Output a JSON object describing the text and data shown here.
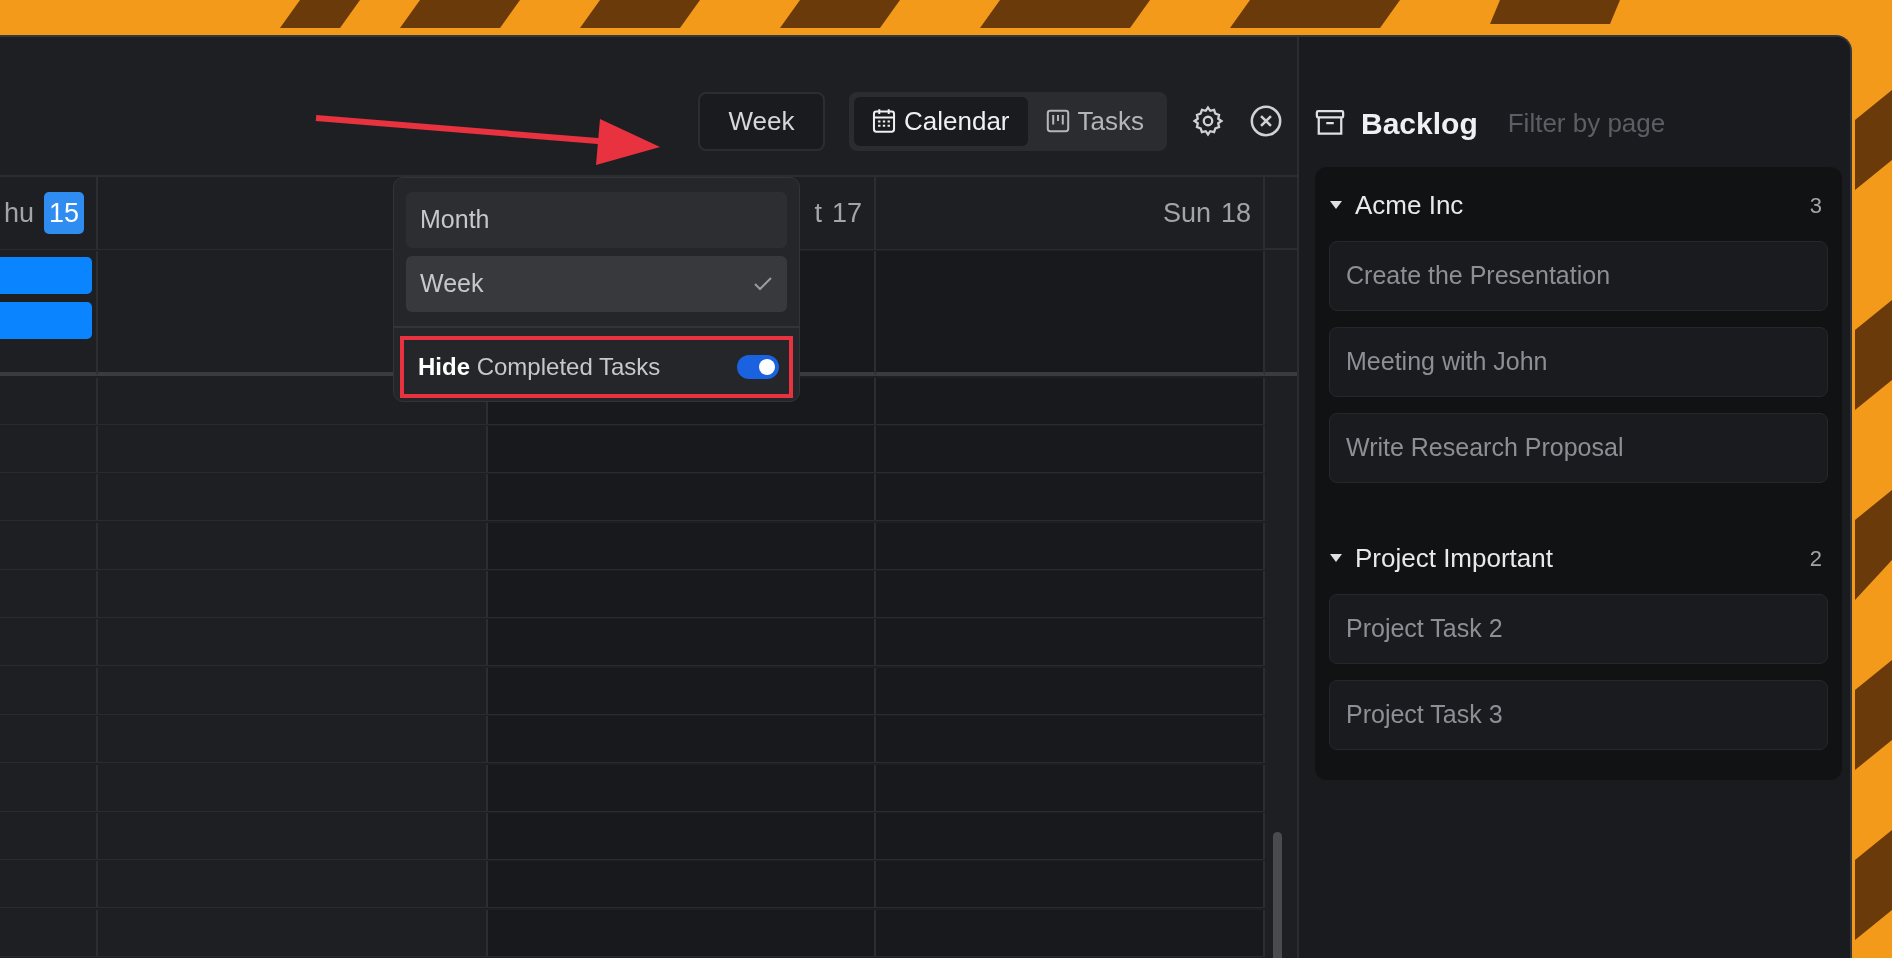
{
  "toolbar": {
    "view_button": {
      "label": "Week"
    },
    "view_tabs": [
      {
        "label": "Calendar",
        "kind": "calendar",
        "selected": true
      },
      {
        "label": "Tasks",
        "kind": "board",
        "selected": false
      }
    ]
  },
  "calendar": {
    "day_headers": [
      {
        "label": "hu",
        "day": "15",
        "today": true
      },
      {
        "label": "t",
        "day": "17",
        "today": false
      },
      {
        "label": "Sun",
        "day": "18",
        "today": false
      }
    ]
  },
  "view_menu": {
    "options": [
      {
        "label": "Month",
        "selected": false
      },
      {
        "label": "Week",
        "selected": true
      }
    ],
    "toggle": {
      "label": "**Hide** Completed Tasks",
      "on": true
    }
  },
  "backlog": {
    "title": "Backlog",
    "filter": {
      "placeholder": "Filter by page"
    },
    "groups": [
      {
        "name": "Acme Inc",
        "count": "3",
        "expanded": true,
        "tasks": [
          "Create the Presentation",
          "Meeting with John",
          "Write Research Proposal"
        ]
      },
      {
        "name": "Project Important",
        "count": "2",
        "expanded": true,
        "tasks": [
          "Project Task 2",
          "Project Task 3"
        ]
      }
    ]
  }
}
